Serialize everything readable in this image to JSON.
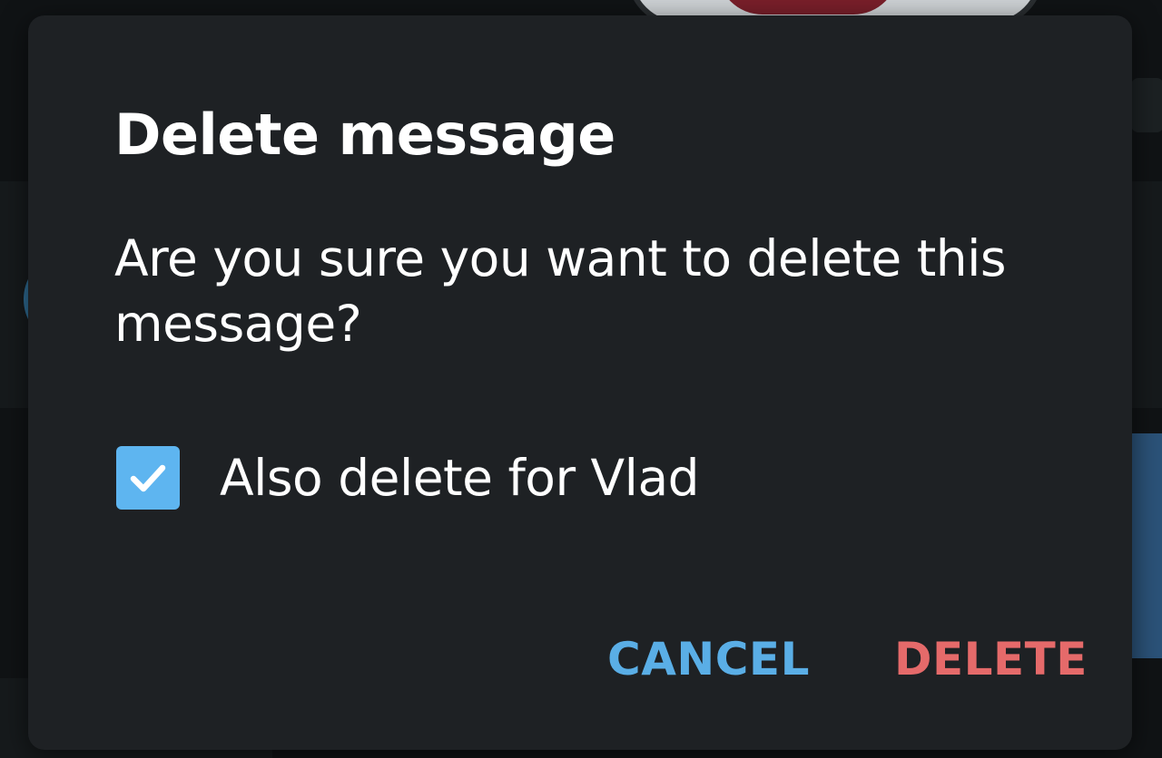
{
  "dialog": {
    "title": "Delete message",
    "message": "Are you sure you want to delete this message?",
    "checkbox": {
      "label": "Also delete for Vlad",
      "checked": true,
      "icon": "checkmark-icon",
      "color": "#5eb5f0"
    },
    "buttons": {
      "cancel": {
        "label": "CANCEL",
        "color": "#5aaee6"
      },
      "delete": {
        "label": "DELETE",
        "color": "#e56a6a"
      }
    },
    "background_color": "#1e2124"
  }
}
